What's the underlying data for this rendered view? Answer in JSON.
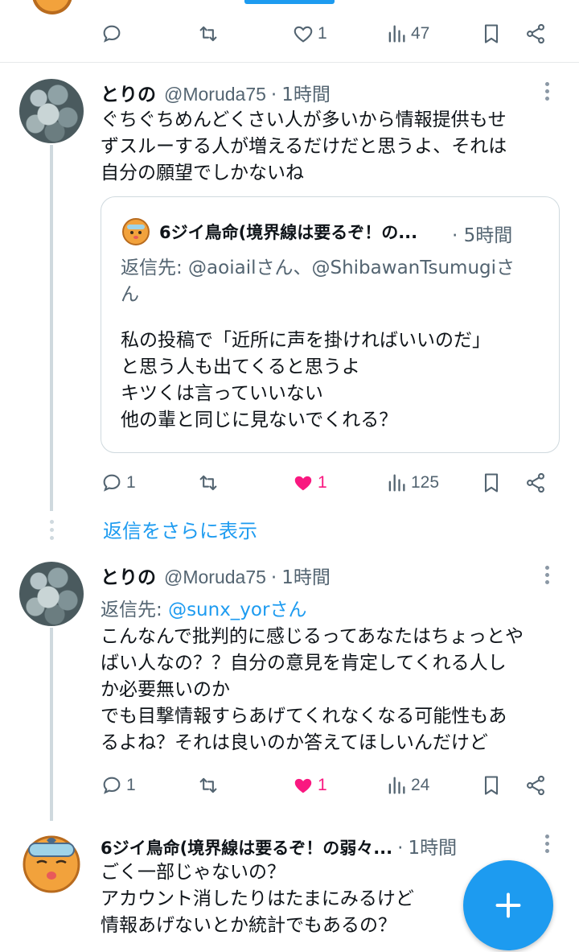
{
  "colors": {
    "accent": "#1d9bf0",
    "like": "#f91880",
    "muted": "#536471"
  },
  "top_tweet": {
    "actions": {
      "reply": "",
      "retweet": "",
      "like": "1",
      "views": "47"
    }
  },
  "reply1": {
    "name": "とりの",
    "handle": "@Moruda75",
    "sep": "·",
    "time": "1時間",
    "text": "ぐちぐちめんどくさい人が多いから情報提供もせ\nずスルーする人が増えるだけだと思うよ、それは\n自分の願望でしかないね",
    "quote": {
      "name": "6ジイ鳥命(境界線は要るぞ！の...",
      "sep": "·",
      "time": "5時間",
      "reply_to": "返信先: @aoiailさん、@ShibawanTsumugiさん",
      "text": "私の投稿で「近所に声を掛ければいいのだ」\nと思う人も出てくると思うよ\nキツくは言っていいない\n他の輩と同じに見ないでくれる？"
    },
    "actions": {
      "reply": "1",
      "retweet": "",
      "like": "1",
      "views": "125"
    }
  },
  "show_more": "返信をさらに表示",
  "reply2": {
    "name": "とりの",
    "handle": "@Moruda75",
    "sep": "·",
    "time": "1時間",
    "reply_to_label": "返信先: ",
    "reply_to_link": "@sunx_yorさん",
    "text": "こんなんで批判的に感じるってあなたはちょっとや\nばい人なの？？自分の意見を肯定してくれる人し\nか必要無いのか\nでも目撃情報すらあげてくれなくなる可能性もあ\nるよね？それは良いのか答えてほしいんだけど",
    "actions": {
      "reply": "1",
      "retweet": "",
      "like": "1",
      "views": "24"
    }
  },
  "reply3": {
    "name": "6ジイ鳥命(境界線は要るぞ！の弱々...",
    "sep": "·",
    "time": "1時間",
    "text": "ごく一部じゃないの？\nアカウント消したりはたまにみるけど\n情報あげないとか統計でもあるの？"
  },
  "icons": {
    "reply": "reply-icon",
    "retweet": "retweet-icon",
    "like": "heart-icon",
    "views": "views-icon",
    "bookmark": "bookmark-icon",
    "share": "share-icon",
    "compose": "plus-icon"
  }
}
